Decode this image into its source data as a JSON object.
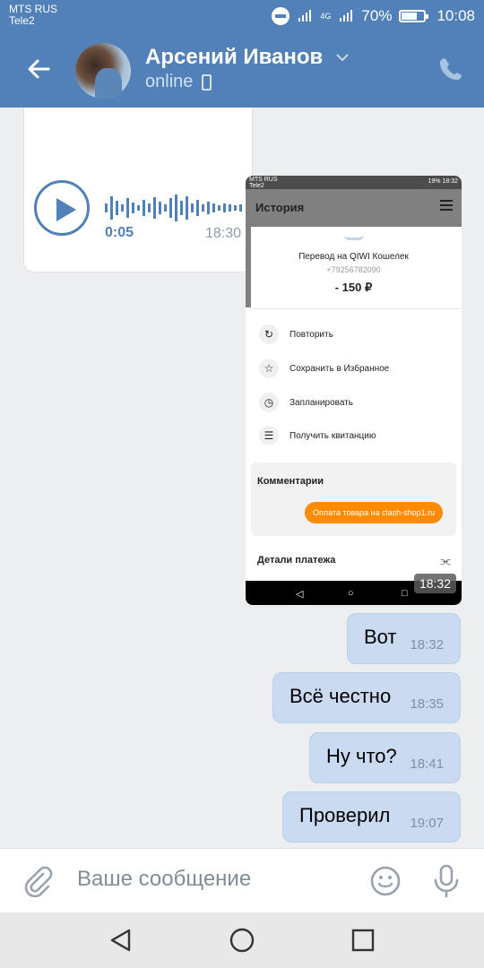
{
  "status_bar": {
    "carrier_1": "MTS RUS",
    "carrier_2": "Tele2",
    "network": "4G",
    "battery": "70%",
    "battery_level": 0.7,
    "time": "10:08"
  },
  "header": {
    "contact_name": "Арсений Иванов",
    "status": "online",
    "back_icon": "arrow-left-icon",
    "call_icon": "phone-icon"
  },
  "messages": {
    "voice": {
      "duration": "0:05",
      "time": "18:30"
    },
    "screenshot": {
      "status_carrier_1": "MTS RUS",
      "status_carrier_2": "Tele2",
      "status_right": "19% 18:32",
      "title": "История",
      "tx_title": "Перевод на QIWI Кошелек",
      "tx_phone": "+79256782090",
      "tx_amount": "- 150 ₽",
      "actions": [
        "Повторить",
        "Сохранить в Избранное",
        "Запланировать",
        "Получить квитанцию"
      ],
      "comments_title": "Комментарии",
      "comment": "Оплата товара на clash-shop1.ru",
      "details_title": "Детали платежа",
      "time": "18:32"
    },
    "outgoing": [
      {
        "text": "Вот",
        "time": "18:32"
      },
      {
        "text": "Всё честно",
        "time": "18:35"
      },
      {
        "text": "Ну что?",
        "time": "18:41"
      },
      {
        "text": "Проверил",
        "time": "19:07"
      }
    ]
  },
  "composer": {
    "placeholder": "Ваше сообщение",
    "attach_icon": "paperclip-icon",
    "emoji_icon": "smile-icon",
    "mic_icon": "microphone-icon"
  },
  "navbar": {
    "back_icon": "triangle-back-icon",
    "home_icon": "circle-home-icon",
    "recents_icon": "square-recents-icon"
  },
  "colors": {
    "header": "#5181b8",
    "background": "#edeef0",
    "outgoing_bubble": "#cadbf1",
    "comment_bubble": "#ff8c00"
  }
}
